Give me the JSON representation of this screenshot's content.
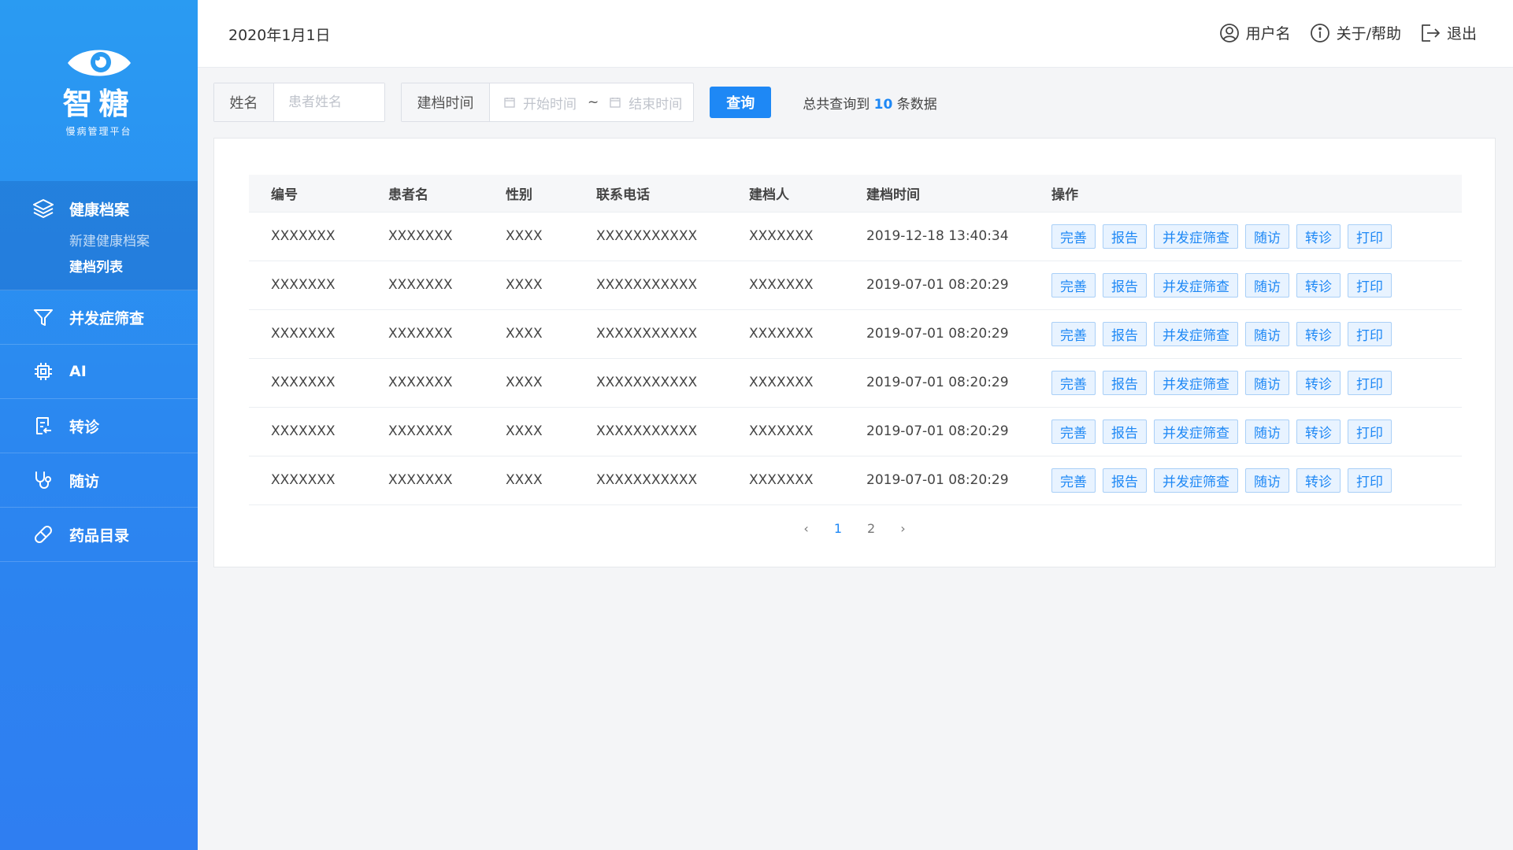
{
  "sidebar": {
    "brand": "智糖",
    "brand_sub": "慢病管理平台",
    "group": {
      "label": "健康档案",
      "icon": "layers-icon",
      "children": [
        "新建健康档案",
        "建档列表"
      ]
    },
    "items": [
      {
        "label": "并发症筛查",
        "icon": "filter-icon"
      },
      {
        "label": "AI",
        "icon": "chip-icon"
      },
      {
        "label": "转诊",
        "icon": "referral-icon"
      },
      {
        "label": "随访",
        "icon": "stethoscope-icon"
      },
      {
        "label": "药品目录",
        "icon": "pill-icon"
      }
    ]
  },
  "header": {
    "date": "2020年1月1日",
    "user": "用户名",
    "about": "关于/帮助",
    "logout": "退出"
  },
  "filter": {
    "name_label": "姓名",
    "name_placeholder": "患者姓名",
    "time_label": "建档时间",
    "start_placeholder": "开始时间",
    "separator": "~",
    "end_placeholder": "结束时间",
    "query_button": "查询",
    "total_prefix": "总共查询到",
    "total_count": "10",
    "total_suffix": "条数据"
  },
  "table": {
    "columns": [
      "编号",
      "患者名",
      "性别",
      "联系电话",
      "建档人",
      "建档时间",
      "操作"
    ],
    "actions": [
      "完善",
      "报告",
      "并发症筛查",
      "随访",
      "转诊",
      "打印"
    ],
    "rows": [
      [
        "XXXXXXX",
        "XXXXXXX",
        "XXXX",
        "XXXXXXXXXXX",
        "XXXXXXX",
        "2019-12-18 13:40:34"
      ],
      [
        "XXXXXXX",
        "XXXXXXX",
        "XXXX",
        "XXXXXXXXXXX",
        "XXXXXXX",
        "2019-07-01 08:20:29"
      ],
      [
        "XXXXXXX",
        "XXXXXXX",
        "XXXX",
        "XXXXXXXXXXX",
        "XXXXXXX",
        "2019-07-01 08:20:29"
      ],
      [
        "XXXXXXX",
        "XXXXXXX",
        "XXXX",
        "XXXXXXXXXXX",
        "XXXXXXX",
        "2019-07-01 08:20:29"
      ],
      [
        "XXXXXXX",
        "XXXXXXX",
        "XXXX",
        "XXXXXXXXXXX",
        "XXXXXXX",
        "2019-07-01 08:20:29"
      ],
      [
        "XXXXXXX",
        "XXXXXXX",
        "XXXX",
        "XXXXXXXXXXX",
        "XXXXXXX",
        "2019-07-01 08:20:29"
      ]
    ]
  },
  "pager": {
    "prev": "‹",
    "pages": [
      "1",
      "2"
    ],
    "current": "1",
    "next": "›"
  },
  "colors": {
    "accent": "#1e88f5",
    "sidebar_top": "#2a9bf2",
    "sidebar_bottom": "#2f7ef1"
  }
}
